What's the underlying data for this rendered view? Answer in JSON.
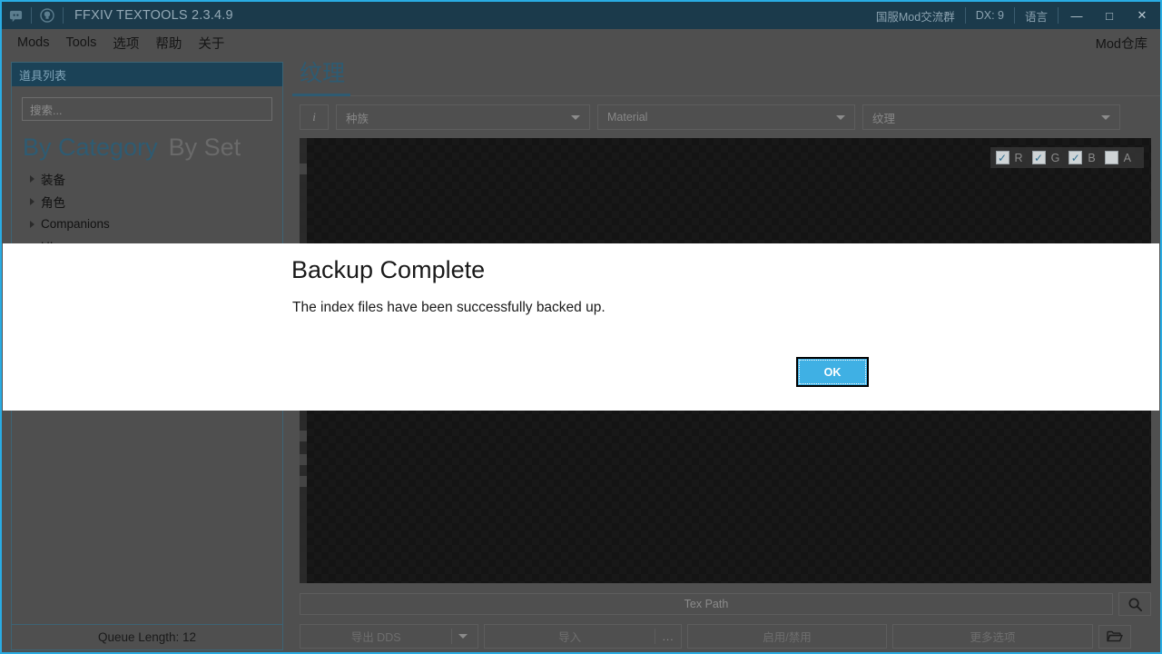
{
  "titlebar": {
    "icons": [
      "discord-icon",
      "github-icon"
    ],
    "app_title": "FFXIV TEXTOOLS 2.3.4.9",
    "right_items": [
      {
        "label": "国服Mod交流群",
        "name": "mod-group-link"
      },
      {
        "label": "DX: 9",
        "name": "directx-version"
      },
      {
        "label": "语言",
        "name": "language-menu"
      }
    ],
    "window_buttons": [
      {
        "glyph": "—",
        "name": "minimize-button"
      },
      {
        "glyph": "□",
        "name": "maximize-button"
      },
      {
        "glyph": "✕",
        "name": "close-button"
      }
    ]
  },
  "menubar": {
    "items": [
      "Mods",
      "Tools",
      "选项",
      "帮助",
      "关于"
    ],
    "right_label": "Mod仓库"
  },
  "sidebar": {
    "header": "道具列表",
    "search_placeholder": "搜索...",
    "tabs": [
      {
        "label": "By Category",
        "active": true
      },
      {
        "label": "By Set",
        "active": false
      }
    ],
    "tree_items": [
      "装备",
      "角色",
      "Companions",
      "UI"
    ],
    "queue_status": "Queue Length: 12"
  },
  "main": {
    "tab_label": "纹理",
    "toolbar": {
      "info_glyph": "i",
      "race_combo": "种族",
      "material_combo": "Material",
      "texture_combo": "纹理"
    },
    "channels": [
      {
        "label": "R",
        "checked": true
      },
      {
        "label": "G",
        "checked": true
      },
      {
        "label": "B",
        "checked": true
      },
      {
        "label": "A",
        "checked": false
      }
    ],
    "tex_path_placeholder": "Tex Path",
    "search_icon": "search-icon",
    "folder_icon": "folder-open-icon",
    "buttons": {
      "export": "导出 DDS",
      "import": "导入",
      "import_more": "...",
      "enable_disable": "启用/禁用",
      "more_options": "更多选项"
    }
  },
  "dialog": {
    "title": "Backup Complete",
    "message": "The index files have been successfully backed up.",
    "ok_label": "OK"
  },
  "colors": {
    "accent_blue": "#29ace3",
    "title_bar": "#1b3a4b",
    "panel_bg": "#4f4f4f",
    "tab_active": "#2e5b72",
    "ok_button": "#3fb0e4"
  }
}
